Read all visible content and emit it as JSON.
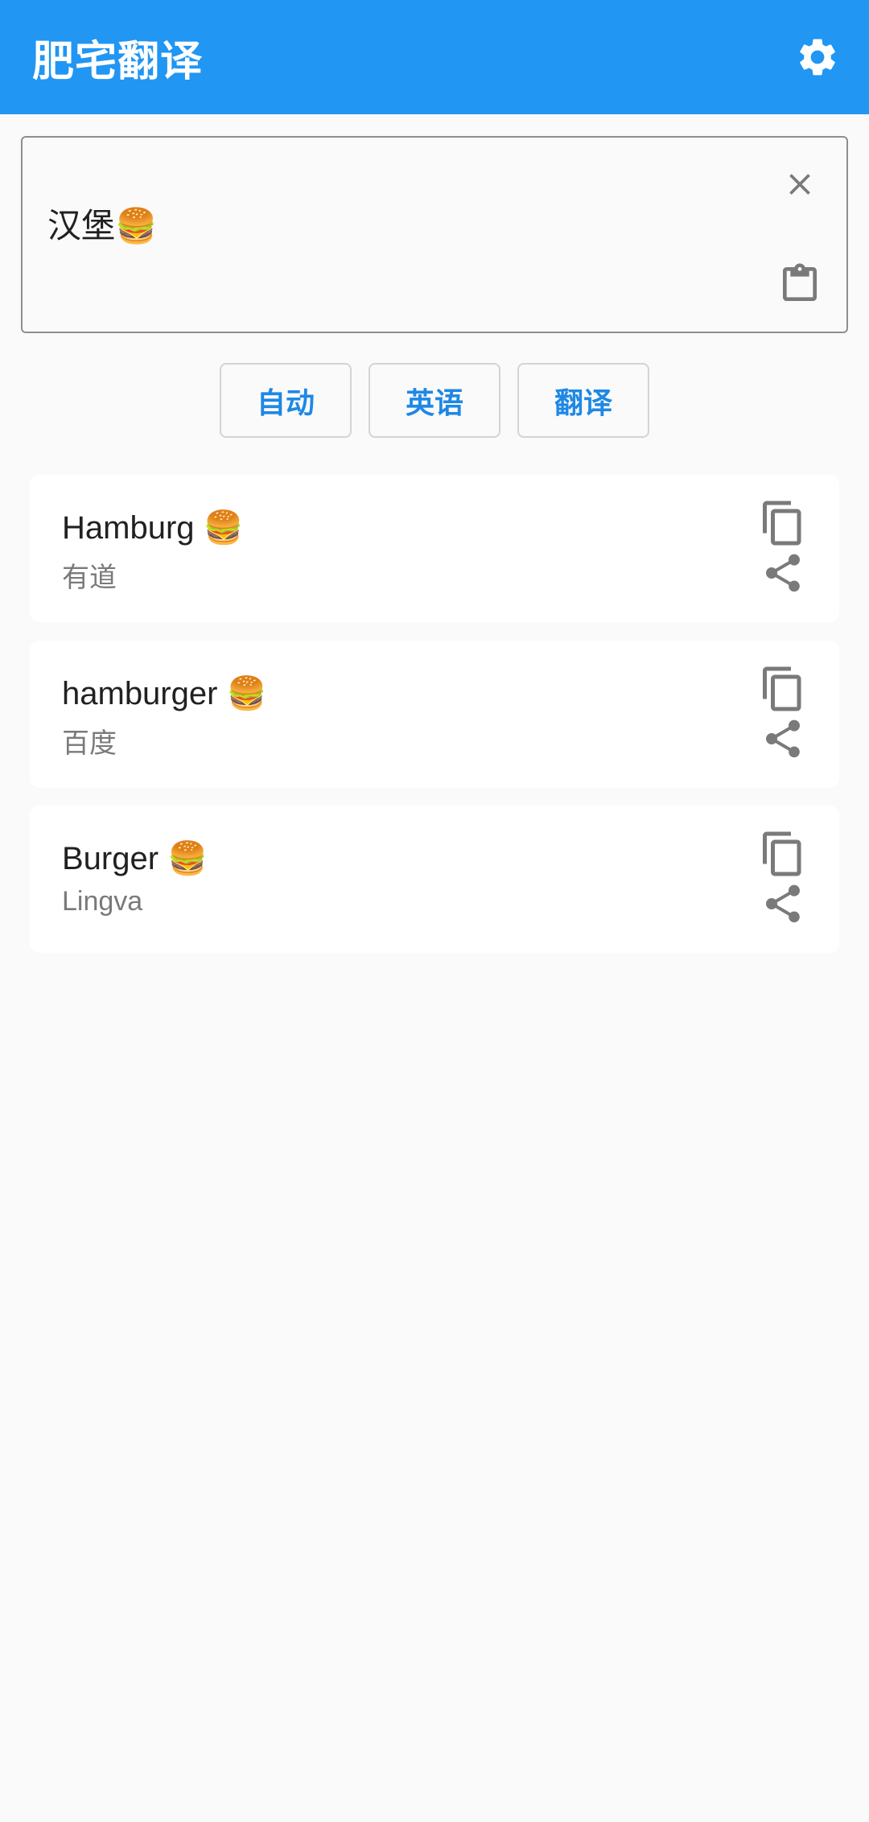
{
  "appbar": {
    "title": "肥宅翻译",
    "settings_icon": "gear-icon"
  },
  "input": {
    "value": "汉堡🍔",
    "clear_icon": "close-icon",
    "paste_icon": "clipboard-icon"
  },
  "buttons": {
    "source_lang": "自动",
    "target_lang": "英语",
    "translate": "翻译"
  },
  "results": [
    {
      "text": "Hamburg 🍔",
      "source": "有道"
    },
    {
      "text": "hamburger 🍔",
      "source": "百度"
    },
    {
      "text": "Burger 🍔",
      "source": "Lingva"
    }
  ],
  "colors": {
    "primary": "#2196f3",
    "button_text": "#1e88e5",
    "icon_gray": "#7a7a7a"
  }
}
